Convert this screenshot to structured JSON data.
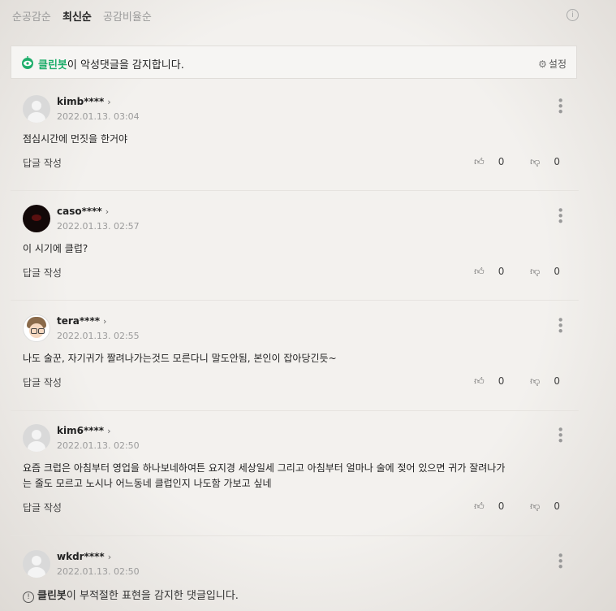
{
  "sort_tabs": [
    "순공감순",
    "최신순",
    "공감비율순"
  ],
  "cleanbot": {
    "brand": "클린봇",
    "message": "이 악성댓글을 감지합니다.",
    "settings_label": "설정"
  },
  "reply_label": "답글 작성",
  "comments": [
    {
      "nick": "kimb****",
      "date": "2022.01.13. 03:04",
      "text": "점심시간에 먼짓을 한거야",
      "likes": "0",
      "dislikes": "0"
    },
    {
      "nick": "caso****",
      "date": "2022.01.13. 02:57",
      "text": "이 시기에 클럽?",
      "likes": "0",
      "dislikes": "0"
    },
    {
      "nick": "tera****",
      "date": "2022.01.13. 02:55",
      "text": "나도 술꾼, 자기귀가 짤려나가는것드 모른다니 말도안됨, 본인이 잡아당긴듯~",
      "likes": "0",
      "dislikes": "0"
    },
    {
      "nick": "kim6****",
      "date": "2022.01.13. 02:50",
      "text_line1": "요즘 크럽은 아침부터 영업을 하나보네하여튼 요지경 세상일세 그리고 아침부터 얼마나 술에 젖어 있으면 귀가 잘려나가",
      "text_line2": "는 줄도 모르고 노시나 어느동네 클럽인지 나도함 가보고 싶네",
      "likes": "0",
      "dislikes": "0"
    },
    {
      "nick": "wkdr****",
      "date": "2022.01.13. 02:50"
    }
  ],
  "blocked_notice": {
    "brand": "클린봇",
    "message": "이 부적절한 표현을 감지한 댓글입니다."
  },
  "colors": {
    "brand_green": "#1fae6b"
  }
}
